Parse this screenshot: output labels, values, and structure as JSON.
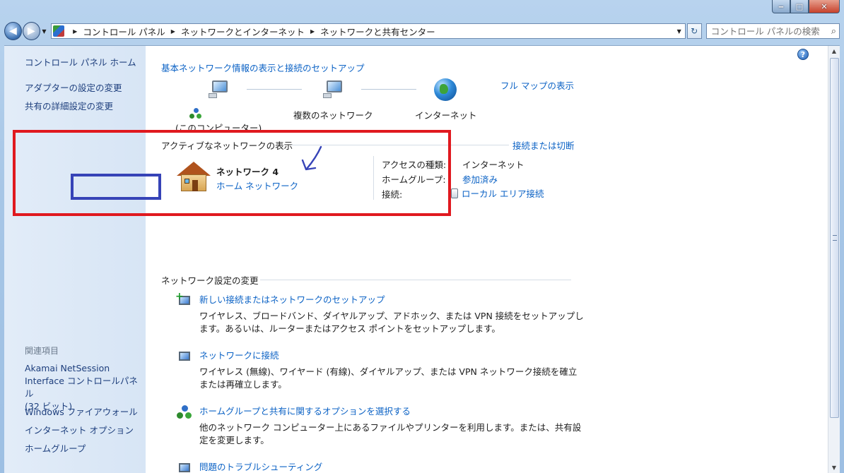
{
  "window": {
    "minimize": "‒",
    "maximize": "□",
    "close": "✕"
  },
  "nav": {
    "breadcrumb": [
      "コントロール パネル",
      "ネットワークとインターネット",
      "ネットワークと共有センター"
    ],
    "search_placeholder": "コントロール パネルの検索"
  },
  "sidebar": {
    "home": "コントロール パネル ホーム",
    "links": [
      "アダプターの設定の変更",
      "共有の詳細設定の変更"
    ],
    "related_heading": "関連項目",
    "related": [
      [
        "Akamai NetSession",
        "Interface コントロールパネル",
        "(32 ビット)"
      ],
      [
        "Windows ファイアウォール"
      ],
      [
        "インターネット オプション"
      ],
      [
        "ホームグループ"
      ]
    ]
  },
  "main": {
    "basic_heading": "基本ネットワーク情報の表示と接続のセットアップ",
    "full_map": "フル マップの表示",
    "map": {
      "computer_label": "(このコンピューター)",
      "networks_label": "複数のネットワーク",
      "internet_label": "インターネット"
    },
    "active": {
      "heading": "アクティブなネットワークの表示",
      "connect_disconnect": "接続または切断",
      "network_name": "ネットワーク 4",
      "network_type": "ホーム ネットワーク",
      "access_type_label": "アクセスの種類:",
      "access_type_value": "インターネット",
      "homegroup_label": "ホームグループ:",
      "homegroup_value": "参加済み",
      "connection_label": "接続:",
      "connection_value": "ローカル エリア接続"
    },
    "change_heading": "ネットワーク設定の変更",
    "tasks": [
      {
        "title": "新しい接続またはネットワークのセットアップ",
        "desc1": "ワイヤレス、ブロードバンド、ダイヤルアップ、アドホック、または VPN 接続をセットアップし",
        "desc2": "ます。あるいは、ルーターまたはアクセス ポイントをセットアップします。"
      },
      {
        "title": "ネットワークに接続",
        "desc1": "ワイヤレス (無線)、ワイヤード (有線)、ダイヤルアップ、または VPN ネットワーク接続を確立",
        "desc2": "または再確立します。"
      },
      {
        "title": "ホームグループと共有に関するオプションを選択する",
        "desc1": "他のネットワーク コンピューター上にあるファイルやプリンターを利用します。または、共有設",
        "desc2": "定を変更します。"
      },
      {
        "title": "問題のトラブルシューティング"
      }
    ]
  },
  "colors": {
    "link": "#0b62c5",
    "annotation_red": "#e0191f",
    "annotation_blue": "#3643b7"
  }
}
